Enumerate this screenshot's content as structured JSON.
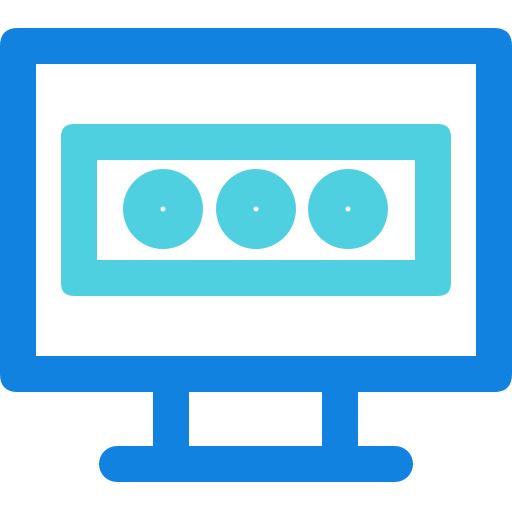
{
  "icon": {
    "name": "monitor-password-icon",
    "description_parts": [
      "monitor-frame",
      "monitor-screen",
      "monitor-neck",
      "monitor-base",
      "password-field",
      "password-dot",
      "password-dot",
      "password-dot"
    ]
  },
  "colors": {
    "monitor": "#1282e0",
    "password_field": "#4fd0e0",
    "background": "#ffffff"
  },
  "password": {
    "dot_count": 3
  }
}
